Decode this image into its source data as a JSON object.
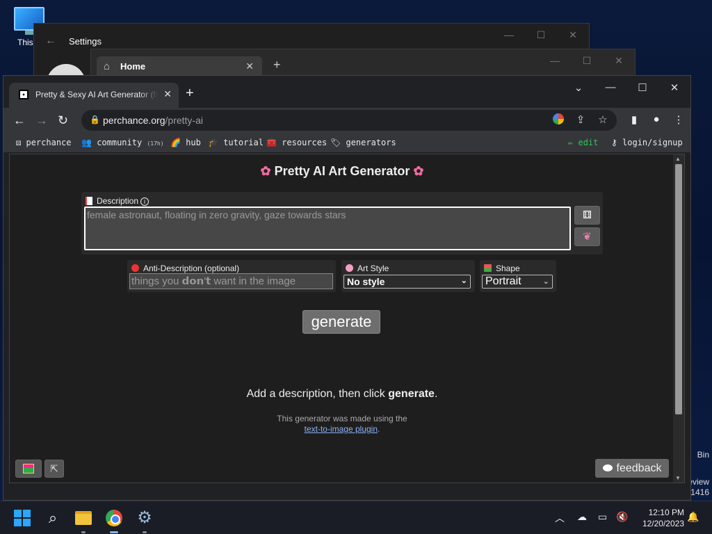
{
  "desktop": {
    "icon_label": "This P",
    "side_text_1": "Bin",
    "side_text_2": "eview",
    "side_text_3": "1416"
  },
  "settings_window": {
    "title": "Settings"
  },
  "home_window": {
    "tab_title": "Home"
  },
  "browser": {
    "tab_title": "Pretty & Sexy AI Art Generator (fr",
    "url_domain": "perchance.org",
    "url_path": "/pretty-ai"
  },
  "bookmarks": [
    {
      "icon": "perchance-icon",
      "label": "perchance"
    },
    {
      "icon": "people-icon",
      "label": "community",
      "badge": "(17h)"
    },
    {
      "icon": "rainbow-icon",
      "label": "hub"
    },
    {
      "icon": "graduation-icon",
      "label": "tutorial"
    },
    {
      "icon": "toolbox-icon",
      "label": "resources"
    },
    {
      "icon": "tag-icon",
      "label": "generators"
    },
    {
      "icon": "pencil-icon",
      "label": "edit"
    },
    {
      "icon": "key-icon",
      "label": "login/signup"
    }
  ],
  "page": {
    "title": "Pretty AI Art Generator",
    "description_label": "Description",
    "description_placeholder": "female astronaut, floating in zero gravity, gaze towards stars",
    "anti_label": "Anti-Description (optional)",
    "anti_placeholder": "things you 𝗱𝗼𝗻'𝘁 want in the image",
    "art_style_label": "Art Style",
    "art_style_value": "No style",
    "shape_label": "Shape",
    "shape_value": "Portrait",
    "generate_label": "generate",
    "hint_prefix": "Add a description, then click ",
    "hint_bold": "generate",
    "hint_suffix": ".",
    "madeby_text": "This generator was made using the",
    "madeby_link": "text-to-image plugin",
    "madeby_suffix": ".",
    "feedback_label": "feedback"
  },
  "taskbar": {
    "time": "12:10 PM",
    "date": "12/20/2023"
  },
  "colors": {
    "accent_pink": "#f06aa0",
    "edit_green": "#35c45a",
    "link_blue": "#8ab4f8"
  }
}
